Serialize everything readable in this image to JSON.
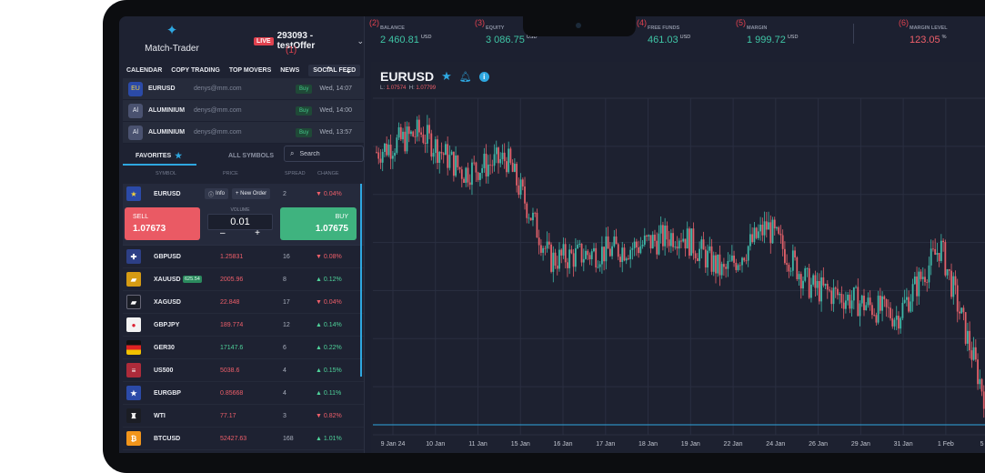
{
  "brand": {
    "logo_icon": "match-trader-logo-icon",
    "name": "Match-Trader"
  },
  "account": {
    "live_badge": "LIVE",
    "label": "293093 - testOffer",
    "marker": "(1)"
  },
  "nav": {
    "items": [
      "CALENDAR",
      "COPY TRADING",
      "TOP MOVERS",
      "NEWS",
      "SOCIAL FEED"
    ]
  },
  "feed": [
    {
      "icon": "EU",
      "symbol": "EURUSD",
      "user": "denys@mm.com",
      "action": "Buy",
      "time": "Wed, 14:07"
    },
    {
      "icon": "Al",
      "symbol": "ALUMINIUM",
      "user": "denys@mm.com",
      "action": "Buy",
      "time": "Wed, 14:00"
    },
    {
      "icon": "Al",
      "symbol": "ALUMINIUM",
      "user": "denys@mm.com",
      "action": "Buy",
      "time": "Wed, 13:57"
    }
  ],
  "tabs": {
    "favorites": "FAVORITES",
    "all_symbols": "ALL SYMBOLS",
    "search_placeholder": "Search"
  },
  "columns": {
    "symbol": "SYMBOL",
    "price": "PRICE",
    "spread": "SPREAD",
    "change": "CHANGE"
  },
  "selected": {
    "symbol": "EURUSD",
    "info_label": "Info",
    "new_order_label": "+ New Order",
    "spread": "2",
    "change": "▼ 0.04%",
    "sell_label": "SELL",
    "sell_price": "1.07673",
    "volume_label": "VOLUME",
    "volume": "0.01",
    "buy_label": "BUY",
    "buy_price": "1.07675",
    "minus": "–",
    "plus": "+"
  },
  "instruments": [
    {
      "symbol": "GBPUSD",
      "price": "1.25831",
      "spread": "16",
      "change": "▼ 0.08%",
      "dir": "down",
      "flag": "flag-gb",
      "glyph": ""
    },
    {
      "symbol": "XAUUSD",
      "badge": "625.54",
      "price": "2005.96",
      "spread": "8",
      "change": "▲ 0.12%",
      "dir": "down-price",
      "flag": "flag-gold",
      "glyph": "▰"
    },
    {
      "symbol": "XAGUSD",
      "price": "22.848",
      "spread": "17",
      "change": "▼ 0.04%",
      "dir": "down",
      "flag": "flag-silver",
      "glyph": "▰"
    },
    {
      "symbol": "GBPJPY",
      "price": "189.774",
      "spread": "12",
      "change": "▲ 0.14%",
      "dir": "down-price",
      "flag": "flag-jp",
      "glyph": "●"
    },
    {
      "symbol": "GER30",
      "price": "17147.6",
      "spread": "6",
      "change": "▲ 0.22%",
      "dir": "up",
      "flag": "flag-de",
      "glyph": ""
    },
    {
      "symbol": "US500",
      "price": "5038.6",
      "spread": "4",
      "change": "▲ 0.15%",
      "dir": "down-price",
      "flag": "flag-us",
      "glyph": ""
    },
    {
      "symbol": "EURGBP",
      "price": "0.85668",
      "spread": "4",
      "change": "▲ 0.11%",
      "dir": "down-price",
      "flag": "flag-eu",
      "glyph": "★"
    },
    {
      "symbol": "WTI",
      "price": "77.17",
      "spread": "3",
      "change": "▼ 0.82%",
      "dir": "down",
      "flag": "flag-wti",
      "glyph": "♜"
    },
    {
      "symbol": "BTCUSD",
      "price": "52427.63",
      "spread": "168",
      "change": "▲ 1.01%",
      "dir": "down-price",
      "flag": "flag-btc",
      "glyph": "₿"
    }
  ],
  "metrics": [
    {
      "num": "(2)",
      "label": "BALANCE",
      "value": "2 460.81",
      "ccy": "USD"
    },
    {
      "num": "(3)",
      "label": "EQUITY",
      "value": "3 086.75",
      "ccy": "USD"
    },
    {
      "num": "(4)",
      "label": "FREE FUNDS",
      "value": "461.03",
      "ccy": "USD"
    },
    {
      "num": "(5)",
      "label": "MARGIN",
      "value": "1 999.72",
      "ccy": "USD"
    },
    {
      "num": "(6)",
      "label": "MARGIN LEVEL",
      "value": "123.05",
      "ccy": "%"
    }
  ],
  "chart": {
    "symbol": "EURUSD",
    "low_label": "L:",
    "low": "1.07574",
    "high_label": "H:",
    "high": "1.07799",
    "x_ticks": [
      "9 Jan 24",
      "10 Jan",
      "11 Jan",
      "15 Jan",
      "16 Jan",
      "17 Jan",
      "18 Jan",
      "19 Jan",
      "22 Jan",
      "24 Jan",
      "26 Jan",
      "29 Jan",
      "31 Jan",
      "1 Feb",
      "5 Feb"
    ],
    "up_color": "#3fb8a8",
    "down_color": "#e2606a"
  },
  "chart_data": {
    "type": "line",
    "title": "EURUSD",
    "x": [
      "9 Jan 24",
      "10 Jan",
      "11 Jan",
      "15 Jan",
      "16 Jan",
      "17 Jan",
      "18 Jan",
      "19 Jan",
      "22 Jan",
      "24 Jan",
      "26 Jan",
      "29 Jan",
      "31 Jan",
      "1 Feb",
      "5 Feb"
    ],
    "series": [
      {
        "values": [
          1.096,
          1.0975,
          1.0945,
          1.0955,
          1.088,
          1.0885,
          1.089,
          1.09,
          1.087,
          1.0905,
          1.086,
          1.085,
          1.0838,
          1.089,
          1.078
        ]
      }
    ],
    "ylim": [
      1.075,
      1.1
    ],
    "grid": true,
    "low": 1.07574,
    "high": 1.07799
  }
}
